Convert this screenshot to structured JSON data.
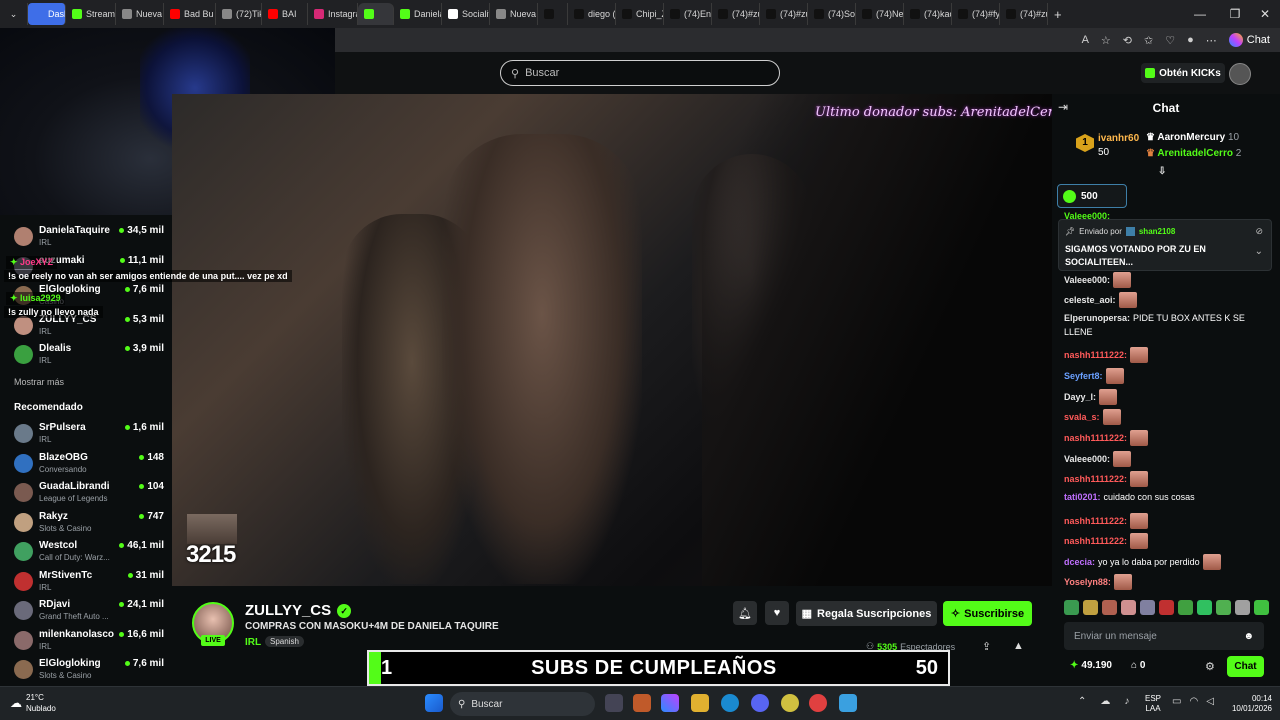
{
  "browser": {
    "tabs": [
      {
        "label": "Dashbo",
        "color": "#3e6ee8"
      },
      {
        "label": "Stream",
        "color": "#53fc18"
      },
      {
        "label": "Nueva",
        "color": "#888888"
      },
      {
        "label": "Bad Bu",
        "color": "#ff0000"
      },
      {
        "label": "(72)Tik",
        "color": "#888888"
      },
      {
        "label": "BAI",
        "color": "#ff0000"
      },
      {
        "label": "Instagra",
        "color": "#d62976"
      },
      {
        "label": "",
        "color": "#53fc18"
      },
      {
        "label": "Daniela",
        "color": "#53fc18"
      },
      {
        "label": "Socialit",
        "color": "#ffffff"
      },
      {
        "label": "Nueva",
        "color": "#888888"
      },
      {
        "label": "",
        "color": "#111111"
      },
      {
        "label": "diego (",
        "color": "#111111"
      },
      {
        "label": "Chipi_Z",
        "color": "#111111"
      },
      {
        "label": "(74)En",
        "color": "#111111"
      },
      {
        "label": "(74)#zu",
        "color": "#111111"
      },
      {
        "label": "(74)#zu",
        "color": "#111111"
      },
      {
        "label": "(74)Sor",
        "color": "#111111"
      },
      {
        "label": "(74)Ne",
        "color": "#111111"
      },
      {
        "label": "(74)kac",
        "color": "#111111"
      },
      {
        "label": "(74)#fy",
        "color": "#111111"
      },
      {
        "label": "(74)#zu",
        "color": "#111111"
      }
    ],
    "new_tab": "+",
    "minimize": "—",
    "maximize": "❐",
    "close": "✕",
    "chat_button": "Chat"
  },
  "header": {
    "search_placeholder": "Buscar",
    "get_kicks": "Obtén KICKs"
  },
  "sidebar": {
    "following": [
      {
        "name": "DanielaTaquire",
        "category": "IRL",
        "viewers": "34,5 mil",
        "avatar": "#b08070"
      },
      {
        "name": "auzumaki",
        "category": "",
        "viewers": "11,1 mil",
        "avatar": "#7a7a8a"
      },
      {
        "name": "ElGlogloking",
        "category": "Casino",
        "viewers": "7,6 mil",
        "avatar": "#8a6a50"
      },
      {
        "name": "ZULLYY_CS",
        "category": "IRL",
        "viewers": "5,3 mil",
        "avatar": "#c09080"
      },
      {
        "name": "Dlealis",
        "category": "IRL",
        "viewers": "3,9 mil",
        "avatar": "#3aa040"
      }
    ],
    "show_more": "Mostrar más",
    "recommended_title": "Recomendado",
    "recommended": [
      {
        "name": "SrPulsera",
        "category": "IRL",
        "viewers": "1,6 mil",
        "avatar": "#6a7a8a"
      },
      {
        "name": "BlazeOBG",
        "category": "Conversando",
        "viewers": "148",
        "avatar": "#3070c0"
      },
      {
        "name": "GuadaLibrandi",
        "category": "League of Legends",
        "viewers": "104",
        "avatar": "#7a5a50"
      },
      {
        "name": "Rakyz",
        "category": "Slots & Casino",
        "viewers": "747",
        "avatar": "#c0a080"
      },
      {
        "name": "Westcol",
        "category": "Call of Duty: Warz...",
        "viewers": "46,1 mil",
        "avatar": "#40a060"
      },
      {
        "name": "MrStivenTc",
        "category": "IRL",
        "viewers": "31 mil",
        "avatar": "#c03030"
      },
      {
        "name": "RDjavi",
        "category": "Grand Theft Auto ...",
        "viewers": "24,1 mil",
        "avatar": "#6a6a7a"
      },
      {
        "name": "milenkanolasco",
        "category": "IRL",
        "viewers": "16,6 mil",
        "avatar": "#8a6a6a"
      },
      {
        "name": "ElGlogloking",
        "category": "Slots & Casino",
        "viewers": "7,6 mil",
        "avatar": "#8a6a50"
      }
    ]
  },
  "stream_overlay": {
    "chat": [
      {
        "user": "JoeXYZ",
        "text": "!s oe reely no van ah ser amigos entiende de una put.... vez pe xd"
      },
      {
        "user": "luisa2929",
        "text": "!s zully no llevo nada"
      }
    ],
    "donor_text": "Ultimo donador subs: ArenitadelCerro",
    "counter": "3215"
  },
  "channel": {
    "name": "ZULLYY_CS",
    "verified": "✓",
    "live": "LIVE",
    "title": "COMPRAS CON MASOKU+4M DE DANIELA TAQUIRE",
    "category": "IRL",
    "language": "Spanish",
    "gift_label": "Regala Suscripciones",
    "subscribe_label": "Suscribirse",
    "viewers": "5305",
    "viewers_label": "Espectadores"
  },
  "goal": {
    "current": "1",
    "title": "SUBS DE CUMPLEAÑOS",
    "target": "50",
    "progress": 0.02
  },
  "chat": {
    "title": "Chat",
    "leaderboard": {
      "first_name": "ivanhr60",
      "first_amount": "50",
      "rank": "1",
      "second_name": "AaronMercury",
      "second_amount": "10",
      "third_name": "ArenitadelCerro",
      "third_amount": "2"
    },
    "kicks_amount": "500",
    "pinned_by_label": "Enviado por",
    "pinned_by_user": "shan2108",
    "pinned_message": "SIGAMOS VOTANDO POR ZU EN SOCIALITEEN...",
    "partial_user": "Valeee000:",
    "messages": [
      {
        "user": "Valeee000:",
        "text": "",
        "color": "#e8e8e8",
        "emote": true
      },
      {
        "user": "celeste_aoi:",
        "text": "",
        "color": "#e8e8e8",
        "emote": true
      },
      {
        "user": "Elperunopersa:",
        "text": "PIDE TU BOX ANTES K SE",
        "color": "#e8e8e8",
        "emote": false
      },
      {
        "user": "",
        "text": "LLENE",
        "color": "#e8e8e8",
        "emote": false
      },
      {
        "user": "nashh1111222:",
        "text": "",
        "color": "#ff5a5a",
        "emote": true
      },
      {
        "user": "Seyfert8:",
        "text": "",
        "color": "#6aa0ff",
        "emote": true
      },
      {
        "user": "Dayy_l:",
        "text": "",
        "color": "#e8e8e8",
        "emote": true
      },
      {
        "user": "svala_s:",
        "text": "",
        "color": "#ff5a5a",
        "emote": true
      },
      {
        "user": "nashh1111222:",
        "text": "",
        "color": "#ff5a5a",
        "emote": true
      },
      {
        "user": "Valeee000:",
        "text": "",
        "color": "#e8e8e8",
        "emote": true
      },
      {
        "user": "nashh1111222:",
        "text": "",
        "color": "#ff5a5a",
        "emote": true
      },
      {
        "user": "tati0201:",
        "text": "cuidado con sus cosas",
        "color": "#c070ff",
        "emote": false
      },
      {
        "user": "nashh1111222:",
        "text": "",
        "color": "#ff5a5a",
        "emote": true
      },
      {
        "user": "nashh1111222:",
        "text": "",
        "color": "#ff5a5a",
        "emote": true
      },
      {
        "user": "dcecia:",
        "text": "yo ya lo daba por perdido",
        "color": "#c070ff",
        "emote": true
      },
      {
        "user": "Yoselyn88:",
        "text": "",
        "color": "#ff8080",
        "emote": true
      }
    ],
    "input_placeholder": "Enviar un mensaje",
    "balance": "49.190",
    "box_count": "0",
    "send_label": "Chat"
  },
  "taskbar": {
    "temperature": "21°C",
    "weather": "Nublado",
    "search_label": "Buscar",
    "language": "ESP",
    "layout": "LAA",
    "time": "00:14",
    "date": "10/01/2026"
  }
}
